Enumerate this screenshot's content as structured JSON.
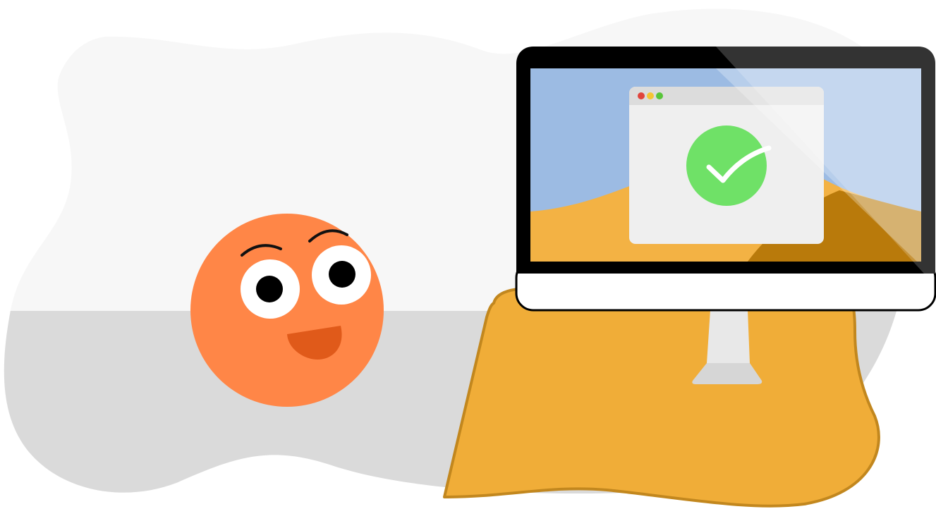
{
  "illustration": {
    "colors": {
      "blob_light": "#f7f7f7",
      "blob_floor": "#dadada",
      "desk": "#f0ad38",
      "desk_outline": "#c2871e",
      "face": "#ff8647",
      "mouth": "#e05a1a",
      "eye_white": "#ffffff",
      "pupil": "#000000",
      "monitor_bezel": "#000000",
      "monitor_chin": "#ffffff",
      "screen_sky": "#9cbbe3",
      "screen_dune": "#f3b244",
      "screen_dune_shadow": "#b97a0b",
      "dialog_bg": "#efefef",
      "dialog_titlebar": "#dcdcdc",
      "dot_close": "#e0443c",
      "dot_minimize": "#f4c534",
      "dot_maximize": "#58c53a",
      "success_circle": "#6fe167",
      "checkmark": "#ffffff",
      "stand": "#e8e8e8",
      "stand_base": "#d6d6d6"
    },
    "icons": {
      "character": "smiling-face-icon",
      "status": "checkmark-icon",
      "window_controls": [
        "close-dot-icon",
        "minimize-dot-icon",
        "maximize-dot-icon"
      ]
    }
  }
}
